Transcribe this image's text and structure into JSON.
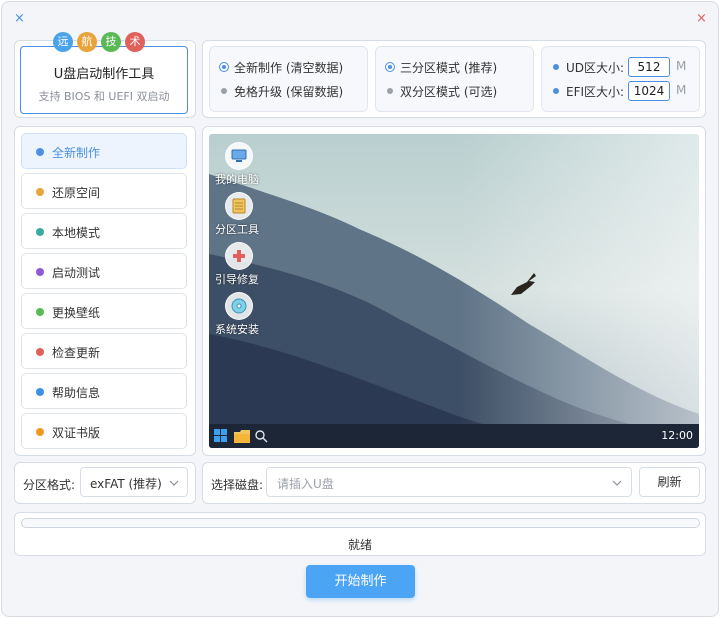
{
  "window": {
    "close_left": "×",
    "close_right": "×"
  },
  "logo": {
    "badges": [
      {
        "text": "远",
        "color": "#4aa3e8"
      },
      {
        "text": "航",
        "color": "#e8a43a"
      },
      {
        "text": "技",
        "color": "#58b955"
      },
      {
        "text": "术",
        "color": "#e0605a"
      }
    ],
    "title": "U盘启动制作工具",
    "subtitle": "支持 BIOS 和 UEFI 双启动"
  },
  "mode": {
    "option1": "全新制作 (清空数据)",
    "option2": "免格升级 (保留数据)"
  },
  "partition_mode": {
    "option1": "三分区模式 (推荐)",
    "option2": "双分区模式 (可选)"
  },
  "sizes": {
    "ud_label": "UD区大小:",
    "ud_value": "512",
    "efi_label": "EFI区大小:",
    "efi_value": "1024",
    "unit": "M"
  },
  "sidebar": {
    "items": [
      {
        "label": "全新制作",
        "color": "#4a90e2"
      },
      {
        "label": "还原空间",
        "color": "#e8a43a"
      },
      {
        "label": "本地模式",
        "color": "#3aa9a0"
      },
      {
        "label": "启动测试",
        "color": "#8e5ad6"
      },
      {
        "label": "更换壁纸",
        "color": "#58b955"
      },
      {
        "label": "检查更新",
        "color": "#e0605a"
      },
      {
        "label": "帮助信息",
        "color": "#3d8fe0"
      },
      {
        "label": "双证书版",
        "color": "#ef9a1f"
      }
    ]
  },
  "desktop": {
    "icons": [
      "我的电脑",
      "分区工具",
      "引导修复",
      "系统安装"
    ],
    "clock": "12:00"
  },
  "format": {
    "label": "分区格式:",
    "value": "exFAT (推荐)"
  },
  "disk": {
    "label": "选择磁盘:",
    "placeholder": "请插入U盘",
    "refresh": "刷新"
  },
  "status": {
    "text": "就绪",
    "progress": 0
  },
  "start_button": "开始制作",
  "colors": {
    "accent": "#4a90e2",
    "button": "#4ca4f5"
  }
}
